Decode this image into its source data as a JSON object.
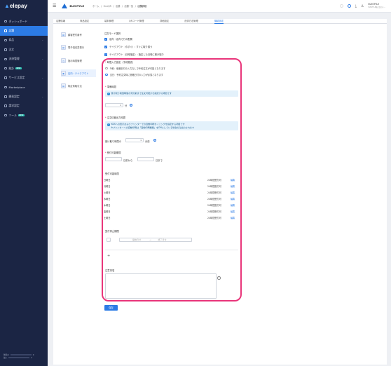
{
  "app": {
    "logo": "elepay"
  },
  "sidebar": {
    "items": [
      {
        "label": "ダッシュボード",
        "chev": ""
      },
      {
        "label": "店舗",
        "chev": ""
      },
      {
        "label": "商品",
        "chev": "⌄"
      },
      {
        "label": "注文",
        "chev": ""
      },
      {
        "label": "決済管理",
        "chev": "⌄"
      },
      {
        "label": "統計",
        "badge": "NEW",
        "chev": ""
      },
      {
        "label": "サービス設定",
        "chev": "⌄"
      },
      {
        "label": "Marketplace",
        "chev": ""
      },
      {
        "label": "開発設定",
        "chev": "⌄"
      },
      {
        "label": "請求設定",
        "chev": ""
      },
      {
        "label": "ツール",
        "badge": "NEW",
        "chev": ""
      }
    ],
    "footer": {
      "line1": "無料の",
      "line2": "加入",
      "count1": "0",
      "count2": "2"
    }
  },
  "topbar": {
    "brand": "ELESTYLE",
    "breadcrumbs": [
      "ホーム",
      "/",
      "OneQR",
      "/",
      "店舗",
      "/",
      "店舗一覧",
      "/"
    ],
    "breadcrumb_current": "店舗詳細",
    "user_name": "ELESTYLE",
    "user_sub": "ELESTYLE株式会社(テ..."
  },
  "tabs": [
    "店舗情報",
    "商品設定",
    "端末管理",
    "QRコード管理",
    "詳細設定",
    "決済方法管理",
    "機能設定"
  ],
  "subnav": [
    "顧客受付番号",
    "電子領収書発行",
    "指示時間管理",
    "店内・テイクアウト",
    "特定商取引法"
  ],
  "form": {
    "order_mode_label": "注文モード選択",
    "order_modes": [
      "店内・店内で行の配置",
      "テイクアウト（今すぐ）: すぐに取り揃う",
      "テイクアウト（日時指定）: 指定した日時に受け取り"
    ],
    "reservation_label": "時間入力設定（予約販売）",
    "reservation_options": [
      "予約：価格日付の入力なしで予約注文が可能となります",
      "当日：予約注文時に価格日付の入力が必須となります"
    ],
    "prep_time_label": "準備時間",
    "prep_time_info": "受け取り希望時間の何分前まで注文可能かを指定する項目です",
    "prep_time_value": "1",
    "prep_time_unit": "分",
    "output_time_label": "注文情報出力時間",
    "output_time_info_1": "KDSへの表示およびプリンターでの自動印刷タイミングを指定する項目です",
    "output_time_info_2": "※プリンターへの自動印刷は「自動印刷機能」をONにしている場合のみ出力されます",
    "output_time_prefix": "受け取り時間の",
    "output_time_value": "1",
    "output_time_unit": "分前",
    "period_label": "受付可能期間",
    "period_from_suffix": "日前から",
    "period_to_suffix": "日まで",
    "hours_label": "受付可能時間",
    "days": [
      {
        "day": "日曜日",
        "hours": "24時間受付可",
        "edit": "編集"
      },
      {
        "day": "月曜日",
        "hours": "24時間受付可",
        "edit": "編集"
      },
      {
        "day": "火曜日",
        "hours": "24時間受付可",
        "edit": "編集"
      },
      {
        "day": "水曜日",
        "hours": "24時間受付可",
        "edit": "編集"
      },
      {
        "day": "木曜日",
        "hours": "24時間受付可",
        "edit": "編集"
      },
      {
        "day": "金曜日",
        "hours": "24時間受付可",
        "edit": "編集"
      },
      {
        "day": "土曜日",
        "hours": "24時間受付可",
        "edit": "編集"
      }
    ],
    "stop_label": "受付停止期間",
    "stop_start_ph": "開始日付",
    "stop_end_ph": "終了日付",
    "notes_label": "注意事項",
    "save_label": "保存"
  }
}
